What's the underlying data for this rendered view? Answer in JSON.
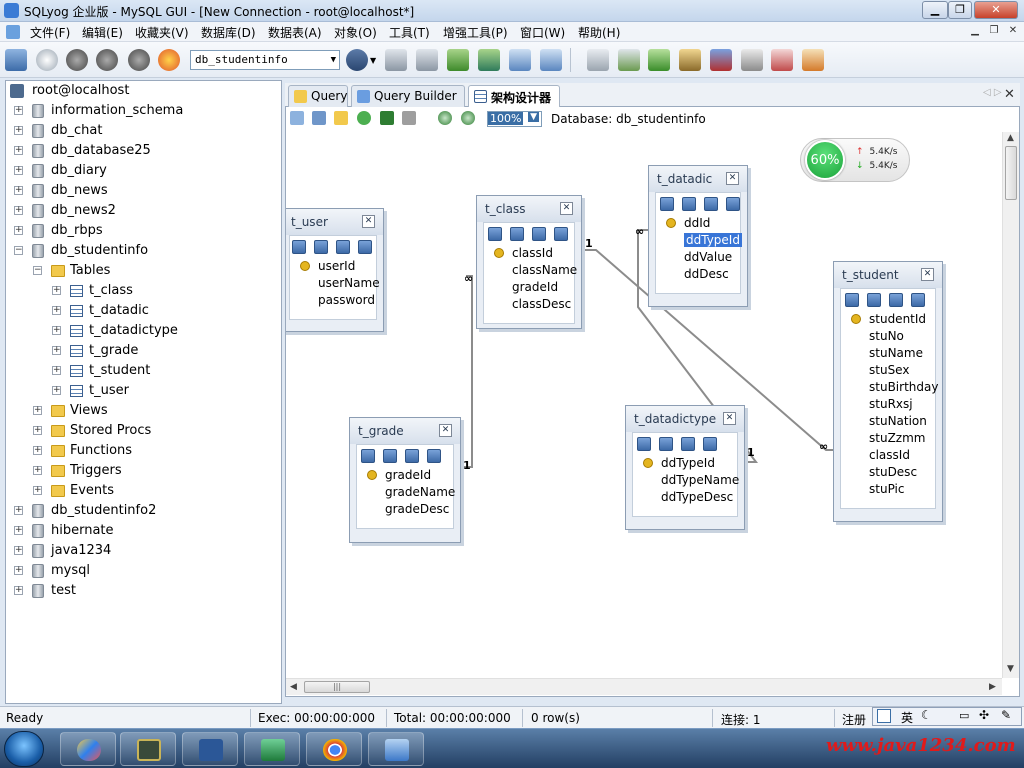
{
  "window": {
    "title": "SQLyog 企业版 - MySQL GUI - [New Connection - root@localhost*]"
  },
  "menu": [
    "文件(F)",
    "编辑(E)",
    "收藏夹(V)",
    "数据库(D)",
    "数据表(A)",
    "对象(O)",
    "工具(T)",
    "增强工具(P)",
    "窗口(W)",
    "帮助(H)"
  ],
  "toolbar": {
    "database_select": "db_studentinfo"
  },
  "tree": {
    "root": "root@localhost",
    "items": [
      {
        "label": "information_schema",
        "type": "db",
        "level": 1,
        "exp": "+"
      },
      {
        "label": "db_chat",
        "type": "db",
        "level": 1,
        "exp": "+"
      },
      {
        "label": "db_database25",
        "type": "db",
        "level": 1,
        "exp": "+"
      },
      {
        "label": "db_diary",
        "type": "db",
        "level": 1,
        "exp": "+"
      },
      {
        "label": "db_news",
        "type": "db",
        "level": 1,
        "exp": "+"
      },
      {
        "label": "db_news2",
        "type": "db",
        "level": 1,
        "exp": "+"
      },
      {
        "label": "db_rbps",
        "type": "db",
        "level": 1,
        "exp": "+"
      },
      {
        "label": "db_studentinfo",
        "type": "db",
        "level": 1,
        "exp": "-"
      },
      {
        "label": "Tables",
        "type": "folder",
        "level": 2,
        "exp": "-"
      },
      {
        "label": "t_class",
        "type": "table",
        "level": 3,
        "exp": "+"
      },
      {
        "label": "t_datadic",
        "type": "table",
        "level": 3,
        "exp": "+"
      },
      {
        "label": "t_datadictype",
        "type": "table",
        "level": 3,
        "exp": "+"
      },
      {
        "label": "t_grade",
        "type": "table",
        "level": 3,
        "exp": "+"
      },
      {
        "label": "t_student",
        "type": "table",
        "level": 3,
        "exp": "+"
      },
      {
        "label": "t_user",
        "type": "table",
        "level": 3,
        "exp": "+"
      },
      {
        "label": "Views",
        "type": "folder",
        "level": 2,
        "exp": "+"
      },
      {
        "label": "Stored Procs",
        "type": "folder",
        "level": 2,
        "exp": "+"
      },
      {
        "label": "Functions",
        "type": "folder",
        "level": 2,
        "exp": "+"
      },
      {
        "label": "Triggers",
        "type": "folder",
        "level": 2,
        "exp": "+"
      },
      {
        "label": "Events",
        "type": "folder",
        "level": 2,
        "exp": "+"
      },
      {
        "label": "db_studentinfo2",
        "type": "db",
        "level": 1,
        "exp": "+"
      },
      {
        "label": "hibernate",
        "type": "db",
        "level": 1,
        "exp": "+"
      },
      {
        "label": "java1234",
        "type": "db",
        "level": 1,
        "exp": "+"
      },
      {
        "label": "mysql",
        "type": "db",
        "level": 1,
        "exp": "+"
      },
      {
        "label": "test",
        "type": "db",
        "level": 1,
        "exp": "+"
      }
    ]
  },
  "tabs": [
    "Query",
    "Query Builder",
    "架构设计器"
  ],
  "designer": {
    "zoom": "100%",
    "database_label": "Database: db_studentinfo"
  },
  "schema": {
    "t_user": {
      "title": "t_user",
      "columns": [
        "userId",
        "userName",
        "password"
      ]
    },
    "t_class": {
      "title": "t_class",
      "columns": [
        "classId",
        "className",
        "gradeId",
        "classDesc"
      ]
    },
    "t_datadic": {
      "title": "t_datadic",
      "columns": [
        "ddId",
        "ddTypeId",
        "ddValue",
        "ddDesc"
      ]
    },
    "t_grade": {
      "title": "t_grade",
      "columns": [
        "gradeId",
        "gradeName",
        "gradeDesc"
      ]
    },
    "t_datadictype": {
      "title": "t_datadictype",
      "columns": [
        "ddTypeId",
        "ddTypeName",
        "ddTypeDesc"
      ]
    },
    "t_student": {
      "title": "t_student",
      "columns": [
        "studentId",
        "stuNo",
        "stuName",
        "stuSex",
        "stuBirthday",
        "stuRxsj",
        "stuNation",
        "stuZzmm",
        "classId",
        "stuDesc",
        "stuPic"
      ]
    }
  },
  "relations": {
    "one": "1",
    "many": "∞"
  },
  "net": {
    "percent": "60%",
    "up": "5.4K/s",
    "down": "5.4K/s"
  },
  "status": {
    "ready": "Ready",
    "exec": "Exec: 00:00:00:000",
    "total": "Total: 00:00:00:000",
    "rows": "0 row(s)",
    "conn": "连接: 1",
    "reg": "注册"
  },
  "ime": {
    "lang": "英"
  },
  "watermark": "www.java1234.com"
}
